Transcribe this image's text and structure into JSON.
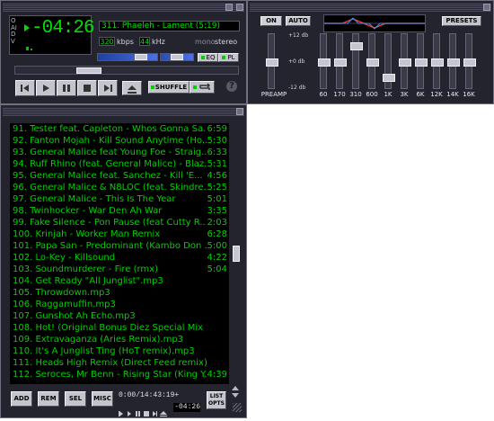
{
  "player": {
    "vertical_flags": "OAIDV",
    "time": "-04:26",
    "track_title": "311. Phaeleh - Lament (5:19)",
    "bitrate": "320",
    "bitrate_unit": "kbps",
    "samplerate": "44",
    "samplerate_unit": "kHz",
    "mono_label": "mono",
    "stereo_label": "stereo",
    "eq_toggle": "EQ",
    "pl_toggle": "PL",
    "shuffle_label": "SHUFFLE",
    "help": "?",
    "seek_position": 0.31,
    "volume_level": 0.78,
    "balance_level": 0.5
  },
  "equalizer": {
    "on_label": "ON",
    "auto_label": "AUTO",
    "presets_label": "PRESETS",
    "db_top": "+12 db",
    "db_mid": "+0 db",
    "db_bottom": "-12 db",
    "preamp_label": "PREAMP",
    "preamp_value": 0,
    "bands": [
      {
        "label": "60",
        "value": 0
      },
      {
        "label": "170",
        "value": 0
      },
      {
        "label": "310",
        "value": 8
      },
      {
        "label": "600",
        "value": 0
      },
      {
        "label": "1K",
        "value": -8
      },
      {
        "label": "3K",
        "value": 0
      },
      {
        "label": "6K",
        "value": 0
      },
      {
        "label": "12K",
        "value": 0
      },
      {
        "label": "14K",
        "value": 0
      },
      {
        "label": "16K",
        "value": 0
      }
    ]
  },
  "playlist": {
    "items": [
      {
        "title": "91. Tester feat. Capleton - Whos Gonna Sa...",
        "duration": "6:59"
      },
      {
        "title": "92. Fanton Mojah - Kill Sound Anytime (Ho...",
        "duration": "5:30"
      },
      {
        "title": "93. General Malice feat Young Foe - Straig...",
        "duration": "6:33"
      },
      {
        "title": "94. Ruff Rhino (feat. General Malice) - Blaz...",
        "duration": "5:31"
      },
      {
        "title": "95. General Malice feat. Sanchez - Kill 'E...",
        "duration": "4:56"
      },
      {
        "title": "96. General Malice & N8LOC (feat. Skindre...",
        "duration": "5:25"
      },
      {
        "title": "97. General Malice - This Is The Year",
        "duration": "5:01"
      },
      {
        "title": "98. Twinhocker - War Den Ah War",
        "duration": "3:35"
      },
      {
        "title": "99. Fake Silence - Pon Pause (feat Cutty R...",
        "duration": "2:03"
      },
      {
        "title": "100. Krinjah - Worker Man Remix",
        "duration": "6:28"
      },
      {
        "title": "101. Papa San - Predominant (Kambo Don ...",
        "duration": "5:00"
      },
      {
        "title": "102. Lo-Key - Killsound",
        "duration": "4:22"
      },
      {
        "title": "103. Soundmurderer - Fire (rmx)",
        "duration": "5:04"
      },
      {
        "title": "104. Get Ready \"All Junglist\".mp3",
        "duration": ""
      },
      {
        "title": "105. Throwdown.mp3",
        "duration": ""
      },
      {
        "title": "106. Raggamuffin.mp3",
        "duration": ""
      },
      {
        "title": "107. Gunshot Ah Echo.mp3",
        "duration": ""
      },
      {
        "title": "108. Hot! (Original Bonus Diez Special Mix Edit)....",
        "duration": ""
      },
      {
        "title": "109. Extravaganza (Aries Remix).mp3",
        "duration": ""
      },
      {
        "title": "110. It's A Junglist Ting (HoT remix).mp3",
        "duration": ""
      },
      {
        "title": "111. Heads High Remix (Direct Feed remix).mp3",
        "duration": ""
      },
      {
        "title": "112. Seroces, Mr Benn - Rising Star (King Y...",
        "duration": "4:39"
      }
    ],
    "add_label": "ADD",
    "rem_label": "REM",
    "sel_label": "SEL",
    "misc_label": "MISC",
    "time_info": "0:00/14:43:19+",
    "mini_time": "-04:26",
    "list_opts_line1": "LIST",
    "list_opts_line2": "OPTS",
    "scroll_position": 0.5
  }
}
